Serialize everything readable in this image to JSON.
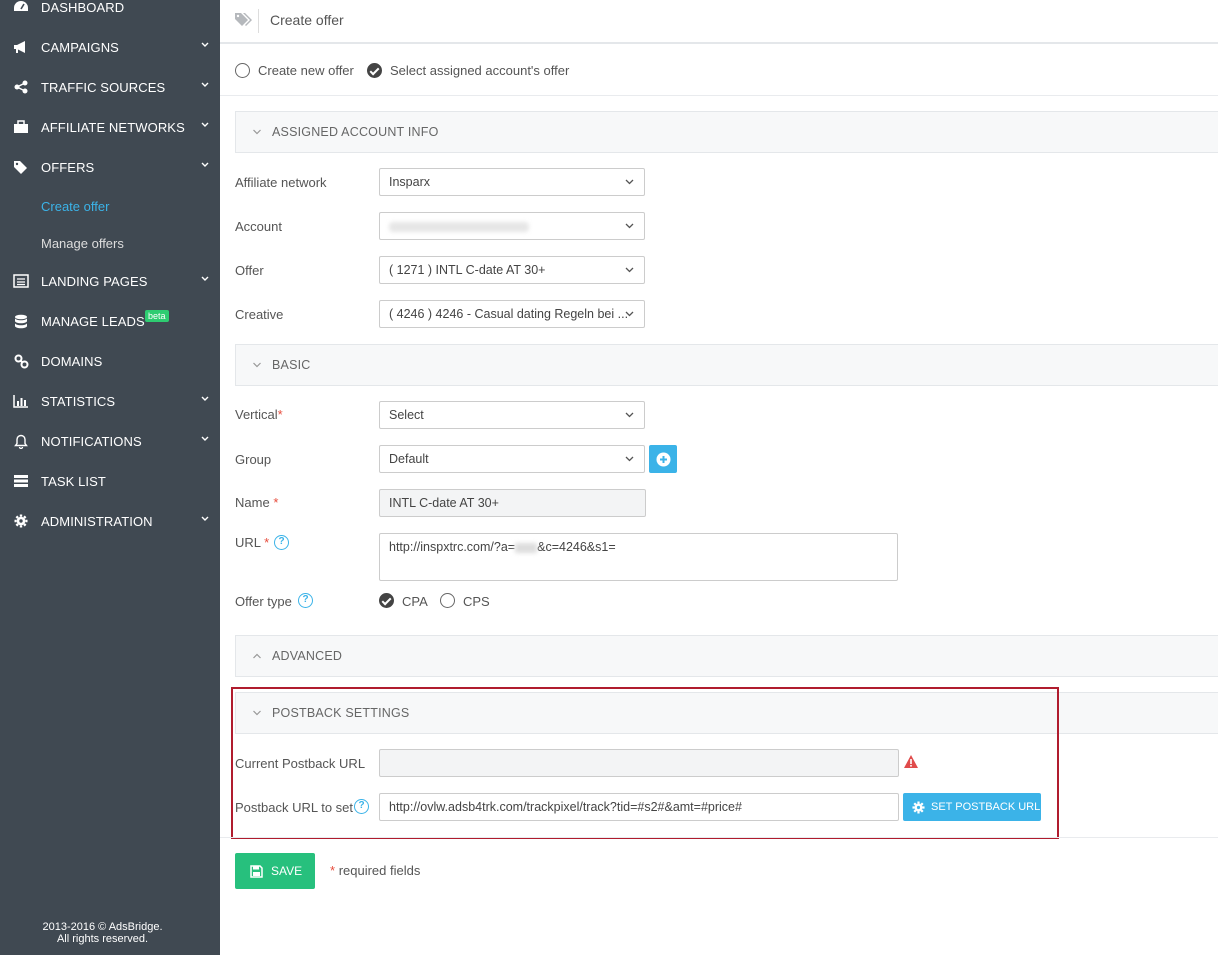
{
  "sidebar": {
    "items": [
      {
        "label": "DASHBOARD",
        "icon": "dashboard-icon"
      },
      {
        "label": "CAMPAIGNS",
        "icon": "megaphone-icon"
      },
      {
        "label": "TRAFFIC SOURCES",
        "icon": "share-icon"
      },
      {
        "label": "AFFILIATE NETWORKS",
        "icon": "briefcase-icon"
      },
      {
        "label": "OFFERS",
        "icon": "tags-icon"
      },
      {
        "label": "LANDING PAGES",
        "icon": "list-alt-icon"
      },
      {
        "label": "MANAGE LEADS",
        "icon": "database-icon"
      },
      {
        "label": "DOMAINS",
        "icon": "link-icon"
      },
      {
        "label": "STATISTICS",
        "icon": "bar-chart-icon"
      },
      {
        "label": "NOTIFICATIONS",
        "icon": "bell-icon"
      },
      {
        "label": "TASK LIST",
        "icon": "tasks-icon"
      },
      {
        "label": "ADMINISTRATION",
        "icon": "gear-icon"
      }
    ],
    "offers_sub": [
      "Create offer",
      "Manage offers"
    ],
    "beta_badge": "beta",
    "copyright_line1": "2013-2016 © AdsBridge.",
    "copyright_line2": "All rights reserved.",
    "active_color": "#3bb3e8"
  },
  "header": {
    "title": "Create offer"
  },
  "mode": {
    "option_new": "Create new offer",
    "option_assigned": "Select assigned account's offer",
    "selected": "assigned"
  },
  "sections": {
    "assigned": "ASSIGNED ACCOUNT INFO",
    "basic": "BASIC",
    "advanced": "ADVANCED",
    "postback": "POSTBACK SETTINGS"
  },
  "assigned": {
    "affiliate_network_label": "Affiliate network",
    "affiliate_network_value": "Insparx",
    "account_label": "Account",
    "offer_label": "Offer",
    "offer_value": "( 1271 ) INTL C-date AT 30+",
    "creative_label": "Creative",
    "creative_value": "( 4246 ) 4246 - Casual dating Regeln bei ..."
  },
  "basic": {
    "vertical_label": "Vertical",
    "vertical_value": "Select",
    "group_label": "Group",
    "group_value": "Default",
    "name_label": "Name",
    "name_value": "INTL C-date AT 30+",
    "url_label": "URL",
    "url_value_prefix": "http://inspxtrc.com/?a=",
    "url_value_suffix": "&c=4246&s1=",
    "offer_type_label": "Offer type",
    "offer_type_cpa": "CPA",
    "offer_type_cps": "CPS",
    "required_mark": "*"
  },
  "postback": {
    "current_label": "Current Postback URL",
    "current_value": "",
    "to_set_label": "Postback URL to set",
    "to_set_value": "http://ovlw.adsb4trk.com/trackpixel/track?tid=#s2#&amt=#price#",
    "set_button": "SET POSTBACK URL"
  },
  "footer": {
    "save_button": "SAVE",
    "required_note": "required fields",
    "required_mark": "*"
  },
  "colors": {
    "sidebar_bg": "#404952",
    "accent": "#3bb3e8",
    "save_green": "#27c07d",
    "highlight_red": "#b01c2e",
    "required_red": "#e74c3c"
  }
}
